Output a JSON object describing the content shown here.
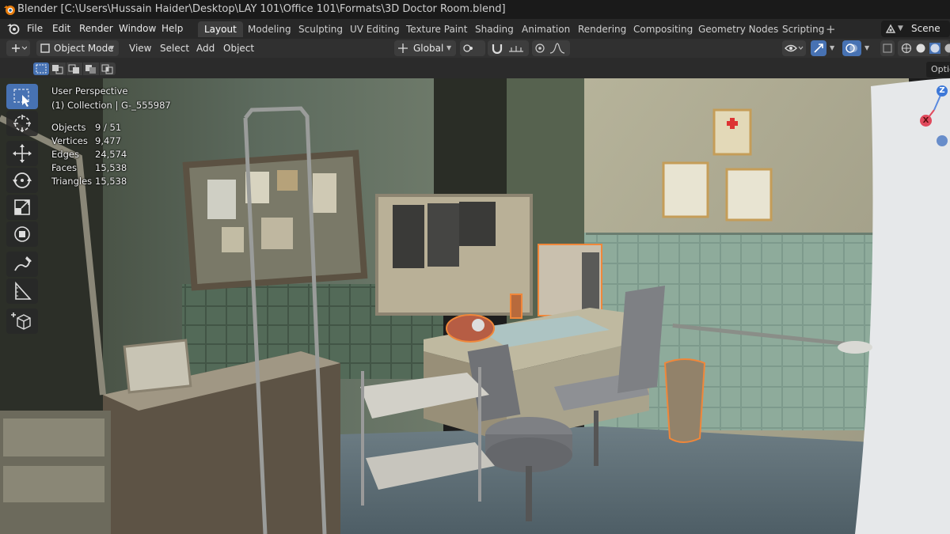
{
  "window": {
    "title": "Blender [C:\\Users\\Hussain Haider\\Desktop\\LAY 101\\Office 101\\Formats\\3D Doctor Room.blend]"
  },
  "menubar": {
    "menus": [
      "File",
      "Edit",
      "Render",
      "Window",
      "Help"
    ],
    "workspaces": [
      "Layout",
      "Modeling",
      "Sculpting",
      "UV Editing",
      "Texture Paint",
      "Shading",
      "Animation",
      "Rendering",
      "Compositing",
      "Geometry Nodes",
      "Scripting"
    ],
    "active_workspace": "Layout",
    "add_tab": "+",
    "scene": "Scene"
  },
  "header": {
    "mode": "Object Mode",
    "menus": [
      "View",
      "Select",
      "Add",
      "Object"
    ],
    "orientation": "Global",
    "options_label": "Optio"
  },
  "overlay": {
    "view_name": "User Perspective",
    "collection": "(1) Collection | G-_555987",
    "stats": [
      {
        "label": "Objects",
        "value": "9 / 51"
      },
      {
        "label": "Vertices",
        "value": "9,477"
      },
      {
        "label": "Edges",
        "value": "24,574"
      },
      {
        "label": "Faces",
        "value": "15,538"
      },
      {
        "label": "Triangles",
        "value": "15,538"
      }
    ]
  },
  "tools": [
    "select-box-icon",
    "cursor-icon",
    "move-icon",
    "rotate-icon",
    "scale-icon",
    "transform-icon",
    "annotate-icon",
    "measure-icon",
    "add-cube-icon"
  ],
  "gizmo": {
    "z": "Z",
    "x": "X"
  },
  "colors": {
    "accent": "#4772b3",
    "selection": "#f0873a",
    "header": "#303030"
  }
}
